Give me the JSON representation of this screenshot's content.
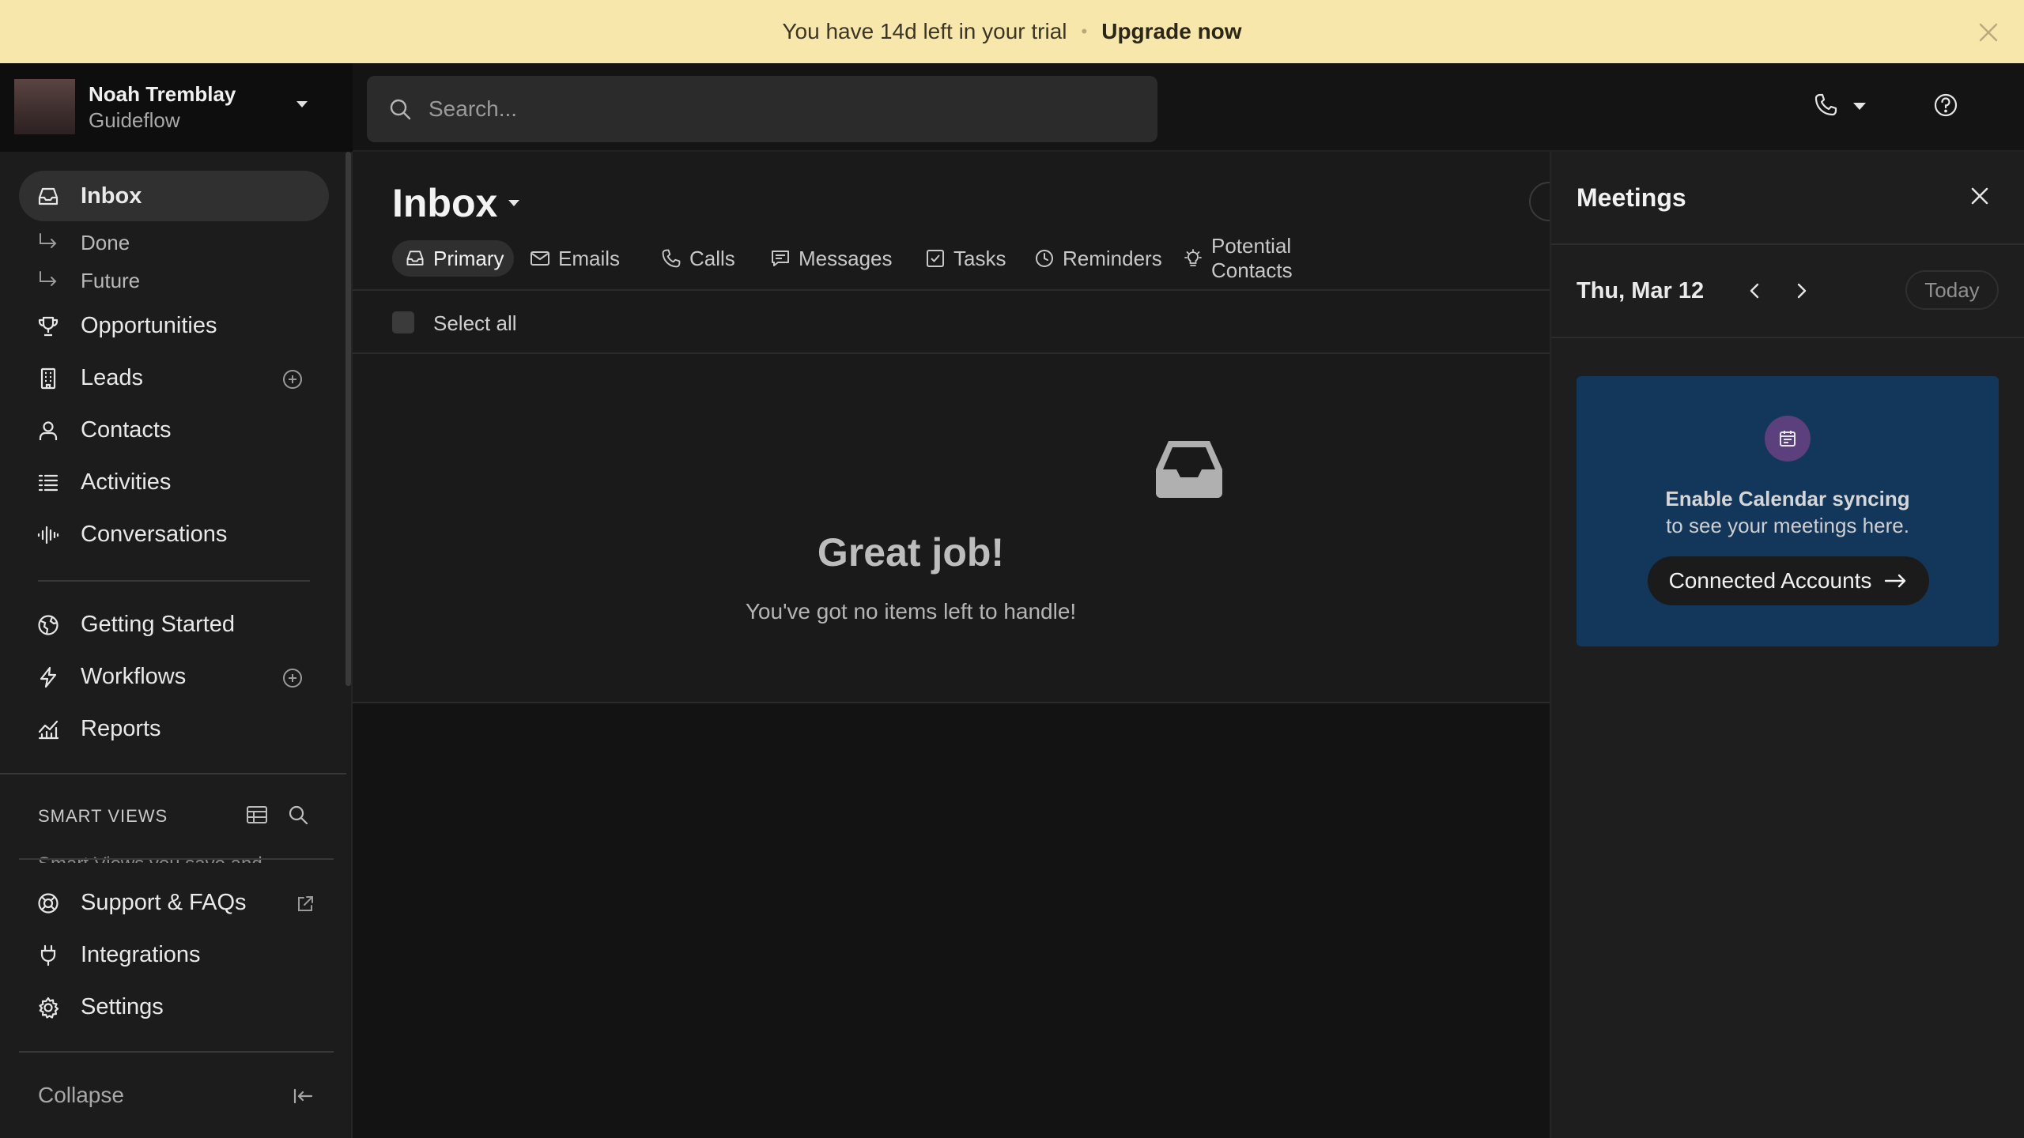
{
  "banner": {
    "message": "You have 14d left in your trial",
    "separator": "•",
    "upgrade_label": "Upgrade now",
    "bg_color": "#f8e7ab"
  },
  "account": {
    "name": "Noah Tremblay",
    "org": "Guideflow"
  },
  "search": {
    "placeholder": "Search..."
  },
  "sidebar": {
    "nav": [
      {
        "label": "Inbox",
        "icon": "inbox-icon",
        "active": true
      },
      {
        "label": "Done",
        "icon": "sub-arrow-icon"
      },
      {
        "label": "Future",
        "icon": "sub-arrow-icon"
      },
      {
        "label": "Opportunities",
        "icon": "trophy-icon"
      },
      {
        "label": "Leads",
        "icon": "building-icon"
      },
      {
        "label": "Contacts",
        "icon": "person-icon"
      },
      {
        "label": "Activities",
        "icon": "list-icon"
      },
      {
        "label": "Conversations",
        "icon": "waveform-icon"
      },
      {
        "label": "Getting Started",
        "icon": "globe-icon"
      },
      {
        "label": "Workflows",
        "icon": "bolt-icon"
      },
      {
        "label": "Reports",
        "icon": "chart-icon"
      }
    ],
    "smart_views_title": "SMART VIEWS",
    "smart_views_cut_text": "Smart Views you save and",
    "footer": [
      {
        "label": "Support & FAQs",
        "icon": "lifebuoy-icon"
      },
      {
        "label": "Integrations",
        "icon": "plug-icon"
      },
      {
        "label": "Settings",
        "icon": "gear-icon"
      }
    ],
    "collapse_label": "Collapse"
  },
  "main": {
    "title": "Inbox",
    "tabs": [
      {
        "label": "Primary",
        "icon": "inbox-icon",
        "active": true
      },
      {
        "label": "Emails",
        "icon": "mail-icon"
      },
      {
        "label": "Calls",
        "icon": "phone-icon"
      },
      {
        "label": "Messages",
        "icon": "message-icon"
      },
      {
        "label": "Tasks",
        "icon": "checkbox-icon"
      },
      {
        "label": "Reminders",
        "icon": "clock-icon"
      },
      {
        "label": "Potential Contacts",
        "icon": "lightbulb-icon"
      }
    ],
    "select_all": "Select all",
    "empty_title": "Great job!",
    "empty_subtitle": "You've got no items left to handle!"
  },
  "meetings": {
    "title": "Meetings",
    "date": "Thu, Mar 12",
    "today_label": "Today",
    "card_heading": "Enable Calendar syncing",
    "card_sub": "to see your meetings here.",
    "card_button": "Connected Accounts",
    "card_color": "#12375a"
  }
}
